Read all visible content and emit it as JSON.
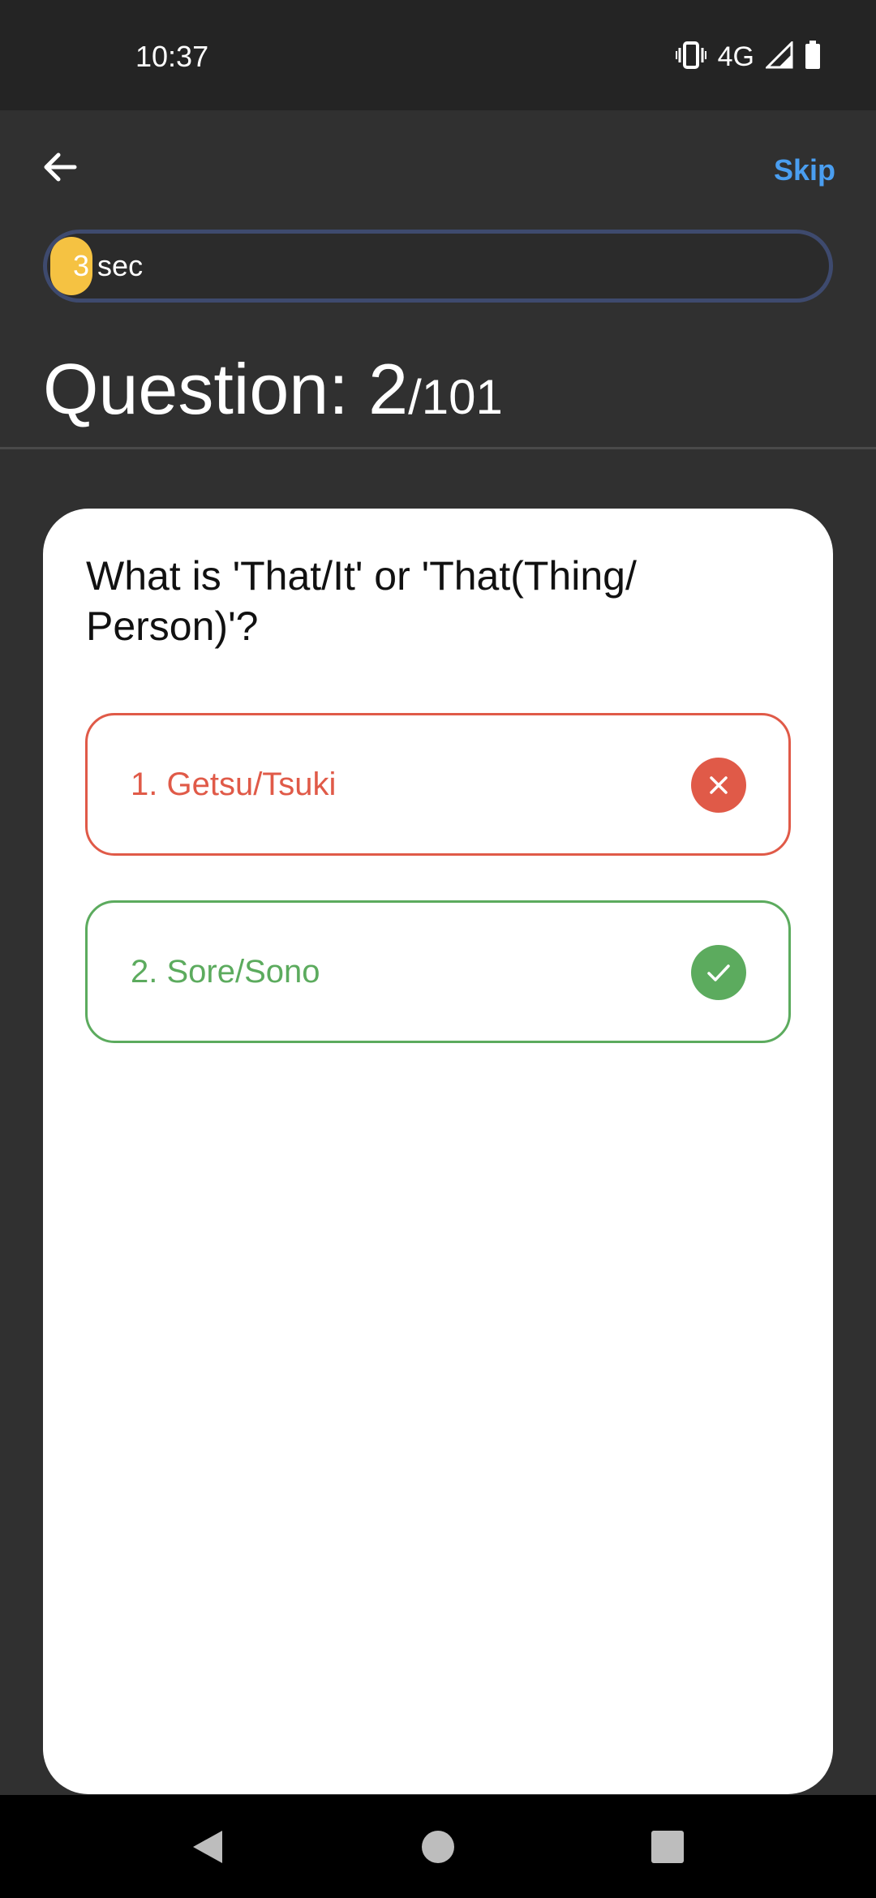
{
  "status_bar": {
    "time": "10:37",
    "network": "4G",
    "icons": [
      "vibrate-icon",
      "signal-icon",
      "battery-icon"
    ]
  },
  "app_bar": {
    "back_icon": "arrow-left-icon",
    "skip_label": "Skip"
  },
  "timer": {
    "value": "3",
    "unit": "sec",
    "accent_color": "#f5c242"
  },
  "question_counter": {
    "label": "Question: 2",
    "total": "/101"
  },
  "question": {
    "text": "What is 'That/It' or 'That(Thing/ Person)'?"
  },
  "options": [
    {
      "label": "1. Getsu/Tsuki",
      "status": "wrong",
      "icon": "close-icon",
      "color": "#e05a48"
    },
    {
      "label": "2. Sore/Sono",
      "status": "correct",
      "icon": "check-icon",
      "color": "#5cab5e"
    }
  ],
  "nav_bar": {
    "buttons": [
      "back-triangle-icon",
      "home-circle-icon",
      "recents-square-icon"
    ]
  }
}
